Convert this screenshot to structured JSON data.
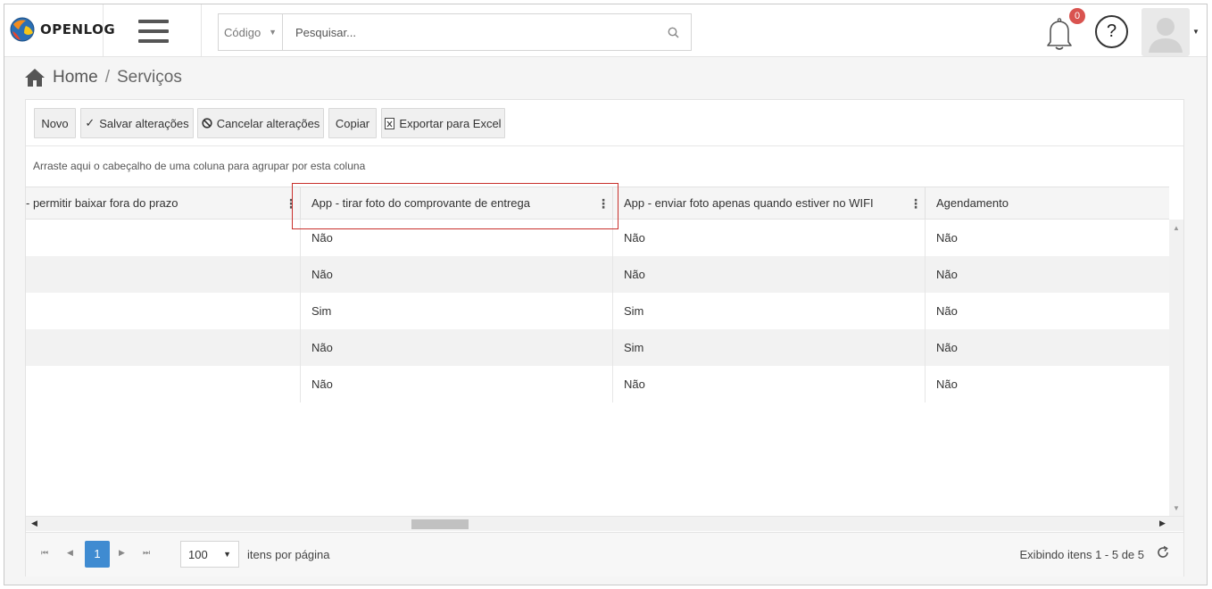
{
  "header": {
    "logo_text": "OPENLOG",
    "search": {
      "filter_selected": "Código",
      "placeholder": "Pesquisar..."
    },
    "notifications_count": "0",
    "help_label": "?"
  },
  "breadcrumb": {
    "home": "Home",
    "separator": "/",
    "current": "Serviços"
  },
  "toolbar": {
    "new_label": "Novo",
    "save_label": "Salvar alterações",
    "cancel_label": "Cancelar alterações",
    "copy_label": "Copiar",
    "export_label": "Exportar para Excel"
  },
  "grid": {
    "group_hint": "Arraste aqui o cabeçalho de uma coluna para agrupar por esta coluna",
    "columns": [
      "- permitir baixar fora do prazo",
      "App - tirar foto do comprovante de entrega",
      "App - enviar foto apenas quando estiver no WIFI",
      "Agendamento"
    ],
    "rows": [
      [
        "",
        "Não",
        "Não",
        "Não"
      ],
      [
        "",
        "Não",
        "Não",
        "Não"
      ],
      [
        "",
        "Sim",
        "Sim",
        "Não"
      ],
      [
        "",
        "Não",
        "Sim",
        "Não"
      ],
      [
        "",
        "Não",
        "Não",
        "Não"
      ]
    ]
  },
  "pager": {
    "current_page": "1",
    "page_size": "100",
    "page_size_label": "itens por página",
    "info": "Exibindo itens 1 - 5 de 5"
  },
  "colors": {
    "accent": "#3f8bd1",
    "badge": "#d9534f",
    "highlight_border": "#c9302c"
  }
}
